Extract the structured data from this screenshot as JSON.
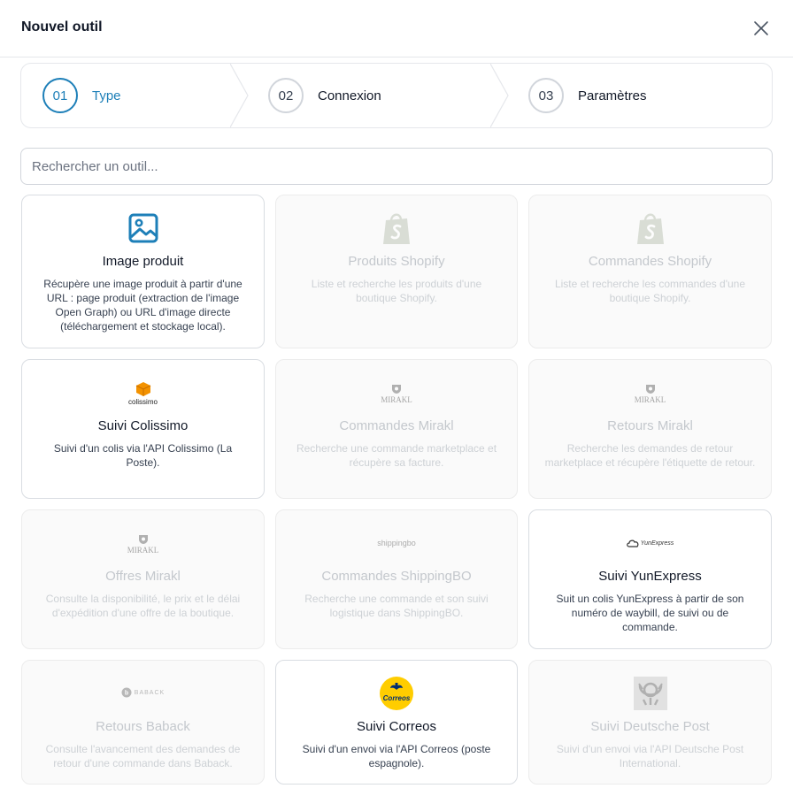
{
  "dialog": {
    "title": "Nouvel outil"
  },
  "stepper": [
    {
      "number": "01",
      "label": "Type",
      "active": true
    },
    {
      "number": "02",
      "label": "Connexion",
      "active": false
    },
    {
      "number": "03",
      "label": "Paramètres",
      "active": false
    }
  ],
  "search": {
    "placeholder": "Rechercher un outil..."
  },
  "tools": [
    {
      "title": "Image produit",
      "description": "Récupère une image produit à partir d'une URL : page produit (extraction de l'image Open Graph) ou URL d'image directe (téléchargement et stockage local).",
      "icon": "image-icon",
      "enabled": true
    },
    {
      "title": "Produits Shopify",
      "description": "Liste et recherche les produits d'une boutique Shopify.",
      "icon": "shopify-logo",
      "enabled": false
    },
    {
      "title": "Commandes Shopify",
      "description": "Liste et recherche les commandes d'une boutique Shopify.",
      "icon": "shopify-logo",
      "enabled": false
    },
    {
      "title": "Suivi Colissimo",
      "description": "Suivi d'un colis via l'API Colissimo (La Poste).",
      "icon": "colissimo-logo",
      "logo_text": "colissimo",
      "enabled": true
    },
    {
      "title": "Commandes Mirakl",
      "description": "Recherche une commande marketplace et récupère sa facture.",
      "icon": "mirakl-logo",
      "logo_text": "MIRAKL",
      "enabled": false
    },
    {
      "title": "Retours Mirakl",
      "description": "Recherche les demandes de retour marketplace et récupère l'étiquette de retour.",
      "icon": "mirakl-logo",
      "logo_text": "MIRAKL",
      "enabled": false
    },
    {
      "title": "Offres Mirakl",
      "description": "Consulte la disponibilité, le prix et le délai d'expédition d'une offre de la boutique.",
      "icon": "mirakl-logo",
      "logo_text": "MIRAKL",
      "enabled": false
    },
    {
      "title": "Commandes ShippingBO",
      "description": "Recherche une commande et son suivi logistique dans ShippingBO.",
      "icon": "shippingbo-logo",
      "logo_text": "shippingbo",
      "enabled": false
    },
    {
      "title": "Suivi YunExpress",
      "description": "Suit un colis YunExpress à partir de son numéro de waybill, de suivi ou de commande.",
      "icon": "yunexpress-logo",
      "logo_text": "YunExpress",
      "enabled": true
    },
    {
      "title": "Retours Baback",
      "description": "Consulte l'avancement des demandes de retour d'une commande dans Baback.",
      "icon": "baback-logo",
      "logo_text": "BABACK",
      "enabled": false
    },
    {
      "title": "Suivi Correos",
      "description": "Suivi d'un envoi via l'API Correos (poste espagnole).",
      "icon": "correos-logo",
      "logo_text": "Correos",
      "enabled": true
    },
    {
      "title": "Suivi Deutsche Post",
      "description": "Suivi d'un envoi via l'API Deutsche Post International.",
      "icon": "deutsche-post-logo",
      "enabled": false
    }
  ],
  "colors": {
    "accent": "#1d7fb8",
    "colissimo": "#f39200",
    "correos": "#ffcd00",
    "correos_blue": "#002d72"
  }
}
